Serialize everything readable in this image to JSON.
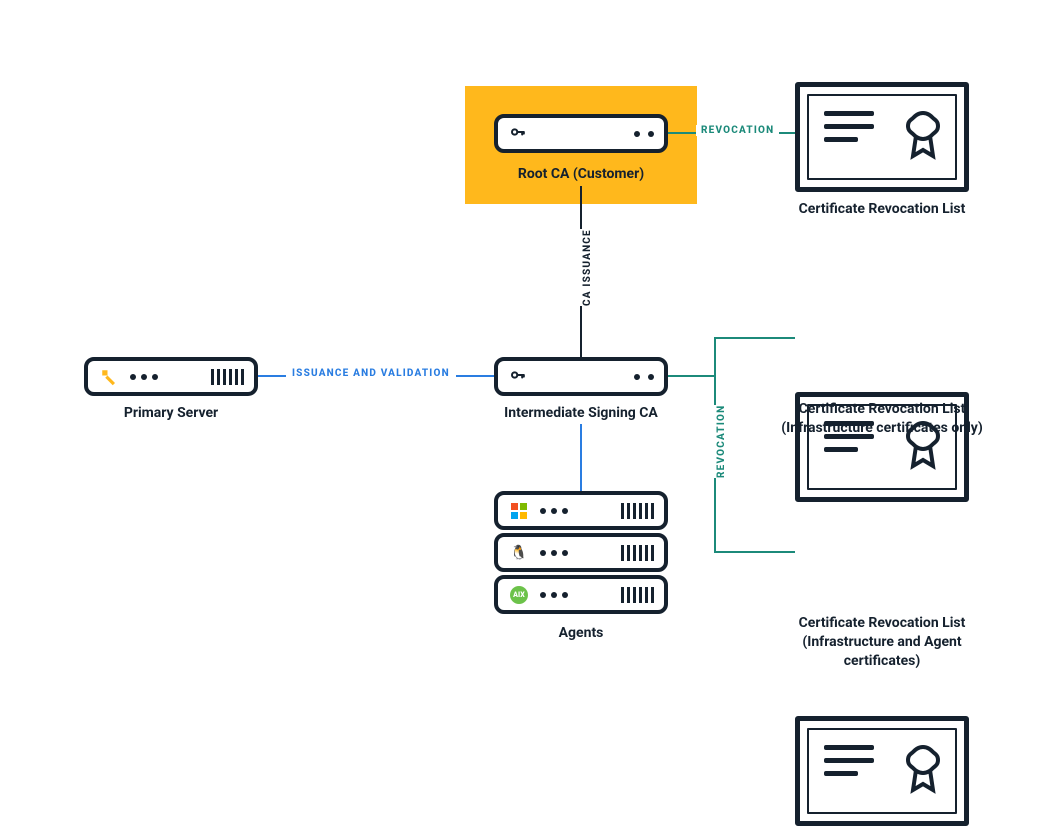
{
  "nodes": {
    "primary_server": {
      "label": "Primary Server",
      "icon": "puppet-icon"
    },
    "root_ca": {
      "label": "Root CA (Customer)",
      "icon": "key-icon"
    },
    "intermediate_ca": {
      "label": "Intermediate Signing CA",
      "icon": "key-icon"
    },
    "agents": {
      "label": "Agents",
      "os_list": [
        "windows",
        "linux",
        "aix"
      ]
    },
    "crl_top": {
      "label": "Certificate Revocation List",
      "icon": "certificate-icon"
    },
    "crl_mid": {
      "label": "Certificate Revocation List (Infrastructure certificates only)",
      "icon": "certificate-icon"
    },
    "crl_bot": {
      "label": "Certificate Revocation List (Infrastructure and Agent certificates)",
      "icon": "certificate-icon"
    }
  },
  "edges": {
    "issuance_validation": {
      "label": "ISSUANCE AND VALIDATION",
      "color": "blue",
      "from": "primary_server",
      "to": "intermediate_ca"
    },
    "ca_issuance": {
      "label": "CA ISSUANCE",
      "color": "navy",
      "from": "root_ca",
      "to": "intermediate_ca"
    },
    "revocation_top": {
      "label": "REVOCATION",
      "color": "teal",
      "from": "root_ca",
      "to": "crl_top"
    },
    "revocation_mid_bot": {
      "label": "REVOCATION",
      "color": "teal",
      "from": "intermediate_ca",
      "to": [
        "crl_mid",
        "crl_bot"
      ]
    },
    "agents_link": {
      "label": "",
      "color": "blue",
      "from": "intermediate_ca",
      "to": "agents"
    }
  },
  "colors": {
    "navy": "#15212e",
    "blue": "#2a7de1",
    "teal": "#1c8a7a",
    "orange": "#ffb81c"
  }
}
